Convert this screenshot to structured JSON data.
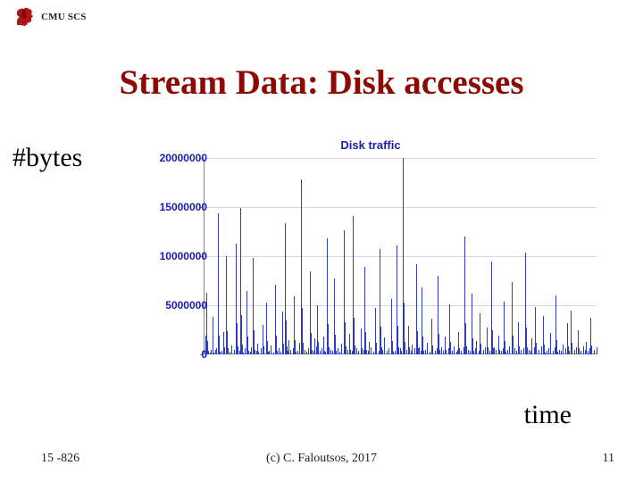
{
  "header": {
    "org": "CMU SCS"
  },
  "title": "Stream Data: Disk accesses",
  "axis_labels": {
    "y": "#bytes",
    "x": "time"
  },
  "footer": {
    "course": "15 -826",
    "credit": "(c) C. Faloutsos, 2017",
    "page": "11"
  },
  "chart_data": {
    "type": "line",
    "title": "Disk traffic",
    "xlabel": "time",
    "ylabel": "#bytes",
    "ylim": [
      0,
      20000000
    ],
    "yticks": [
      0,
      5000000,
      10000000,
      15000000,
      20000000
    ],
    "series": [
      {
        "name": "disk traffic",
        "values": [
          400000,
          0,
          1900000,
          6300000,
          1400000,
          400000,
          0,
          200000,
          500000,
          0,
          3800000,
          1000000,
          200000,
          0,
          500000,
          600000,
          0,
          14400000,
          1900000,
          300000,
          0,
          400000,
          0,
          2300000,
          700000,
          0,
          10000000,
          2400000,
          600000,
          0,
          300000,
          0,
          900000,
          200000,
          0,
          0,
          500000,
          0,
          11300000,
          3200000,
          800000,
          0,
          400000,
          14900000,
          4000000,
          1000000,
          200000,
          0,
          600000,
          0,
          6500000,
          1800000,
          400000,
          0,
          300000,
          0,
          700000,
          0,
          9800000,
          2500000,
          500000,
          0,
          400000,
          1100000,
          300000,
          0,
          0,
          600000,
          0,
          3000000,
          800000,
          0,
          0,
          5300000,
          1400000,
          300000,
          0,
          400000,
          0,
          900000,
          0,
          0,
          200000,
          0,
          7100000,
          1900000,
          400000,
          0,
          600000,
          0,
          300000,
          0,
          4400000,
          1100000,
          0,
          13400000,
          3500000,
          800000,
          0,
          400000,
          1500000,
          0,
          500000,
          0,
          0,
          600000,
          5900000,
          1500000,
          300000,
          0,
          400000,
          0,
          1200000,
          0,
          17800000,
          4700000,
          1200000,
          0,
          500000,
          0,
          300000,
          0,
          0,
          600000,
          0,
          8500000,
          2200000,
          500000,
          0,
          400000,
          1600000,
          0,
          800000,
          5000000,
          1300000,
          0,
          400000,
          0,
          600000,
          0,
          1800000,
          400000,
          0,
          300000,
          0,
          11800000,
          3100000,
          700000,
          0,
          500000,
          0,
          400000,
          0,
          7700000,
          2000000,
          400000,
          0,
          600000,
          0,
          300000,
          0,
          1100000,
          0,
          0,
          400000,
          12600000,
          3300000,
          800000,
          0,
          500000,
          0,
          2100000,
          500000,
          0,
          400000,
          14100000,
          3700000,
          900000,
          0,
          600000,
          0,
          400000,
          0,
          0,
          2600000,
          600000,
          0,
          0,
          500000,
          8900000,
          2300000,
          500000,
          0,
          400000,
          1300000,
          0,
          700000,
          0,
          0,
          300000,
          0,
          4700000,
          1200000,
          0,
          0,
          400000,
          10700000,
          2800000,
          700000,
          0,
          500000,
          0,
          1700000,
          0,
          0,
          400000,
          0,
          600000,
          0,
          0,
          5600000,
          1400000,
          300000,
          0,
          400000,
          0,
          11100000,
          2900000,
          700000,
          0,
          600000,
          0,
          400000,
          0,
          20000000,
          5300000,
          1300000,
          0,
          500000,
          0,
          2900000,
          700000,
          0,
          400000,
          1000000,
          0,
          0,
          600000,
          0,
          9200000,
          2400000,
          600000,
          0,
          700000,
          0,
          400000,
          6800000,
          1800000,
          400000,
          0,
          500000,
          0,
          1200000,
          0,
          0,
          300000,
          0,
          3600000,
          900000,
          0,
          0,
          400000,
          0,
          600000,
          0,
          8000000,
          2100000,
          500000,
          0,
          700000,
          0,
          400000,
          0,
          1800000,
          500000,
          0,
          0,
          600000,
          5100000,
          1300000,
          0,
          400000,
          0,
          800000,
          0,
          0,
          300000,
          0,
          500000,
          2300000,
          600000,
          0,
          400000,
          0,
          0,
          700000,
          12000000,
          3200000,
          800000,
          0,
          500000,
          0,
          400000,
          0,
          6200000,
          1600000,
          400000,
          0,
          600000,
          0,
          1400000,
          0,
          0,
          400000,
          4200000,
          1100000,
          0,
          0,
          500000,
          0,
          700000,
          0,
          2700000,
          700000,
          0,
          400000,
          0,
          9500000,
          2500000,
          600000,
          0,
          700000,
          0,
          500000,
          0,
          0,
          1900000,
          500000,
          0,
          400000,
          0,
          600000,
          5400000,
          1400000,
          300000,
          0,
          500000,
          0,
          800000,
          0,
          0,
          7400000,
          1900000,
          400000,
          0,
          600000,
          0,
          400000,
          0,
          3300000,
          800000,
          0,
          500000,
          0,
          0,
          600000,
          0,
          10400000,
          2700000,
          700000,
          0,
          500000,
          0,
          400000,
          1600000,
          400000,
          0,
          0,
          700000,
          4800000,
          1200000,
          0,
          0,
          500000,
          0,
          0,
          800000,
          0,
          3900000,
          1000000,
          200000,
          0,
          400000,
          0,
          600000,
          0,
          2200000,
          500000,
          0,
          0,
          400000,
          0,
          700000,
          6000000,
          1500000,
          300000,
          0,
          500000,
          0,
          400000,
          0,
          1000000,
          0,
          0,
          600000,
          0,
          3200000,
          800000,
          0,
          400000,
          0,
          4500000,
          1200000,
          0,
          0,
          500000,
          0,
          700000,
          0,
          2500000,
          600000,
          0,
          400000,
          0,
          0,
          800000,
          0,
          500000,
          1300000,
          0,
          0,
          400000,
          0,
          600000,
          3700000,
          900000,
          0,
          0,
          500000,
          0,
          0,
          700000
        ]
      }
    ]
  }
}
